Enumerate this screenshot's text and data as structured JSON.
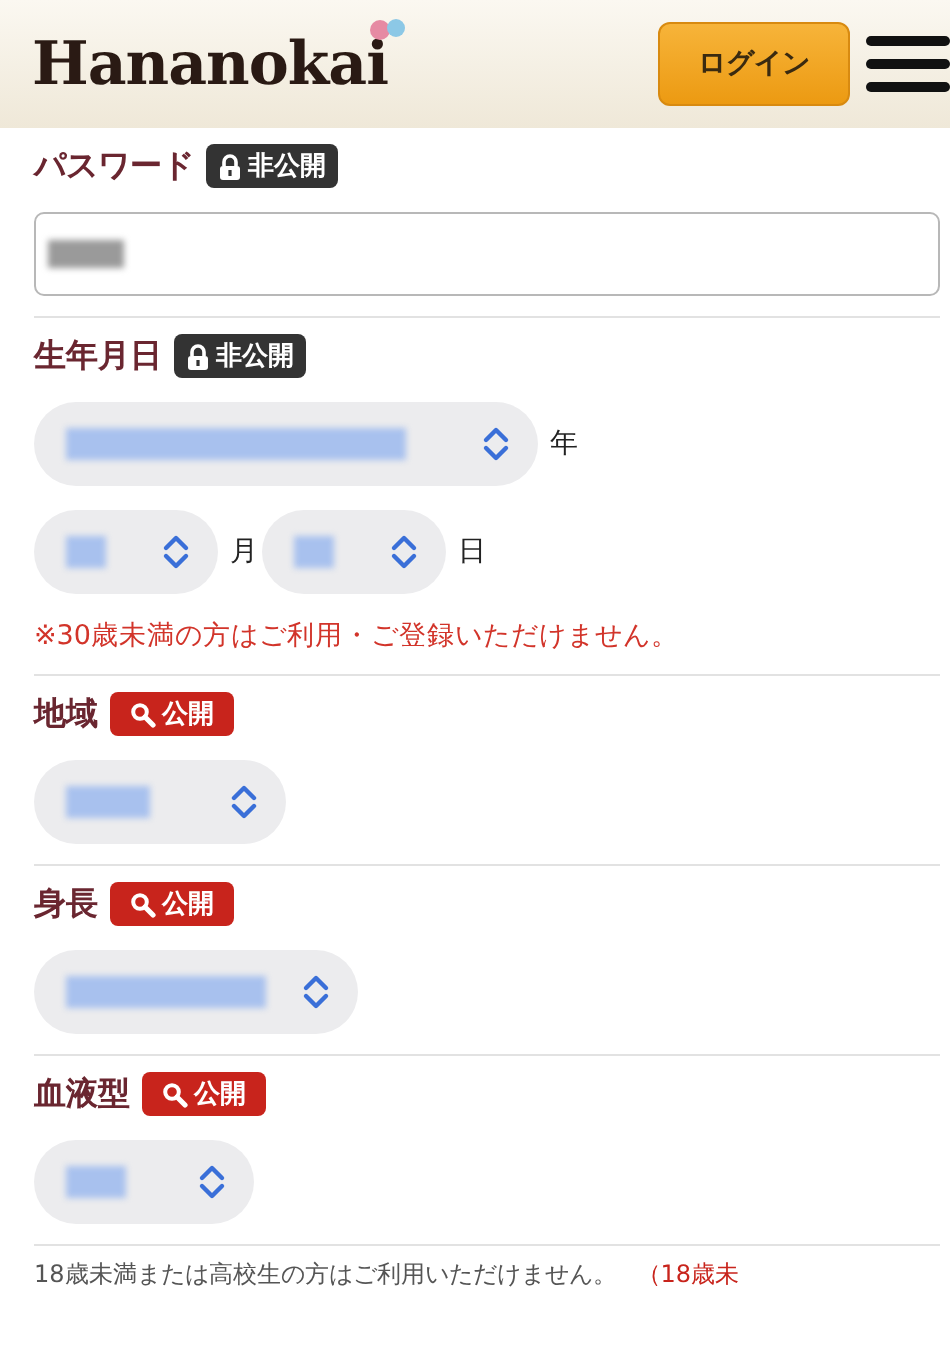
{
  "header": {
    "logo": "Hananokai",
    "login_button": "ログイン"
  },
  "sections": [
    {
      "kind": "text",
      "label": "パスワード",
      "badge": {
        "kind": "private",
        "text": "非公開"
      }
    },
    {
      "kind": "date",
      "label": "生年月日",
      "badge": {
        "kind": "private",
        "text": "非公開"
      },
      "rows": [
        [
          {
            "unit": "年"
          }
        ],
        [
          {
            "unit": "月"
          },
          {
            "unit": "日"
          }
        ]
      ],
      "note": "※30歳未満の方はご利用・ご登録いただけません。"
    },
    {
      "kind": "select",
      "label": "地域",
      "badge": {
        "kind": "public",
        "text": "公開"
      }
    },
    {
      "kind": "select",
      "label": "身長",
      "badge": {
        "kind": "public",
        "text": "公開"
      }
    },
    {
      "kind": "select",
      "label": "血液型",
      "badge": {
        "kind": "public",
        "text": "公開"
      }
    }
  ],
  "footer_note": {
    "text": "18歳未満または高校生の方はご利用いただけません。",
    "link": "（18歳未"
  }
}
